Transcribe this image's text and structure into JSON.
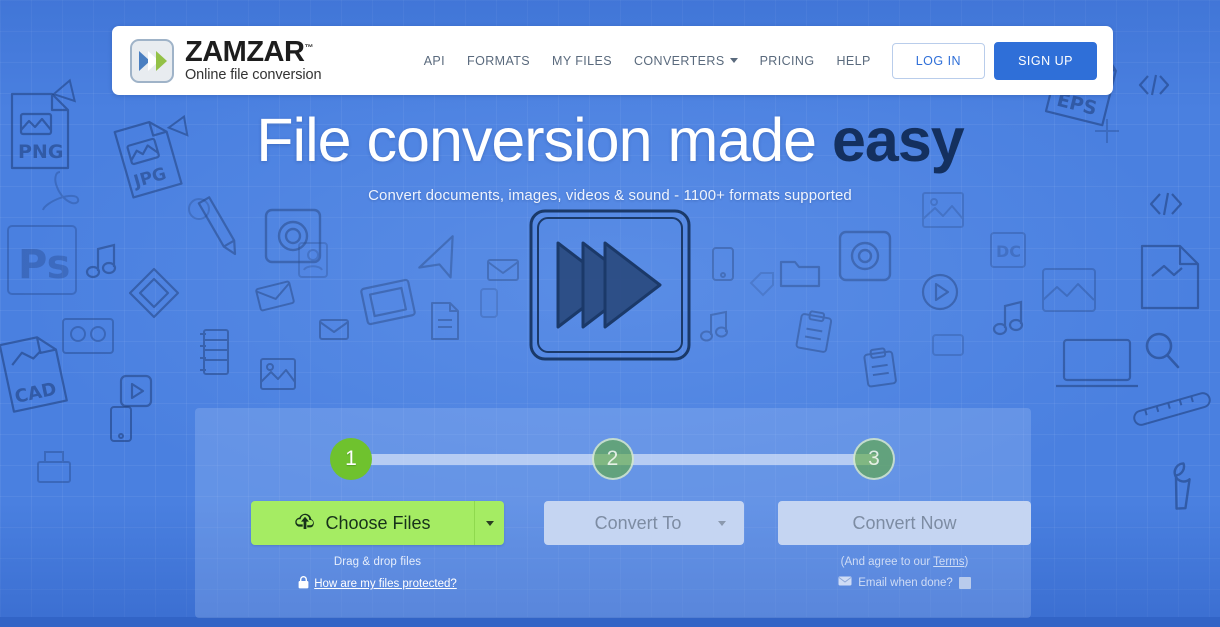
{
  "brand": {
    "wordmark": "ZAMZAR",
    "trademark": "™",
    "tagline": "Online file conversion",
    "logo_icon": "double-chevron-icon",
    "accent_blue": "#2f6fd8",
    "accent_green": "#a5ec63",
    "background_blue": "#4a80e0",
    "headline_accent": "#14305f"
  },
  "nav": {
    "items": [
      {
        "label": "API",
        "has_dropdown": false
      },
      {
        "label": "FORMATS",
        "has_dropdown": false
      },
      {
        "label": "MY FILES",
        "has_dropdown": false
      },
      {
        "label": "CONVERTERS",
        "has_dropdown": true
      },
      {
        "label": "PRICING",
        "has_dropdown": false
      },
      {
        "label": "HELP",
        "has_dropdown": false
      }
    ],
    "login_label": "LOG IN",
    "signup_label": "SIGN UP"
  },
  "hero": {
    "title_main": "File conversion made ",
    "title_accent": "easy",
    "subtitle": "Convert documents, images, videos & sound - 1100+ formats supported",
    "artwork_icon": "sketch-play-triangles-icon"
  },
  "converter": {
    "steps": [
      {
        "number": "1",
        "state": "active"
      },
      {
        "number": "2",
        "state": "idle"
      },
      {
        "number": "3",
        "state": "idle"
      }
    ],
    "choose_files": {
      "label": "Choose Files",
      "icon": "cloud-upload-icon",
      "dropdown_icon": "caret-down-icon",
      "drag_drop_text": "Drag & drop files",
      "protection_link": "How are my files protected?",
      "lock_icon": "lock-icon"
    },
    "convert_to": {
      "label": "Convert To",
      "dropdown_icon": "caret-down-icon",
      "disabled": true
    },
    "convert_now": {
      "label": "Convert Now",
      "disabled": true,
      "terms_prefix": "(And agree to our ",
      "terms_link": "Terms",
      "terms_suffix": ")",
      "email_label": "Email when done?",
      "email_icon": "envelope-icon",
      "email_checked": false
    }
  },
  "background": {
    "doodles": [
      "png-file-doodle",
      "jpg-file-doodle",
      "photoshop-doodle",
      "cad-file-doodle",
      "acrobat-doodle",
      "music-note-doodle",
      "pencil-doodle",
      "wrench-doodle",
      "camera-doodle",
      "folder-doodle",
      "envelope-doodle",
      "eps-file-doodle",
      "illustrator-doodle",
      "code-brackets-doodle",
      "laptop-doodle",
      "magnifier-doodle",
      "ruler-doodle",
      "play-button-doodle",
      "video-doodle"
    ]
  }
}
